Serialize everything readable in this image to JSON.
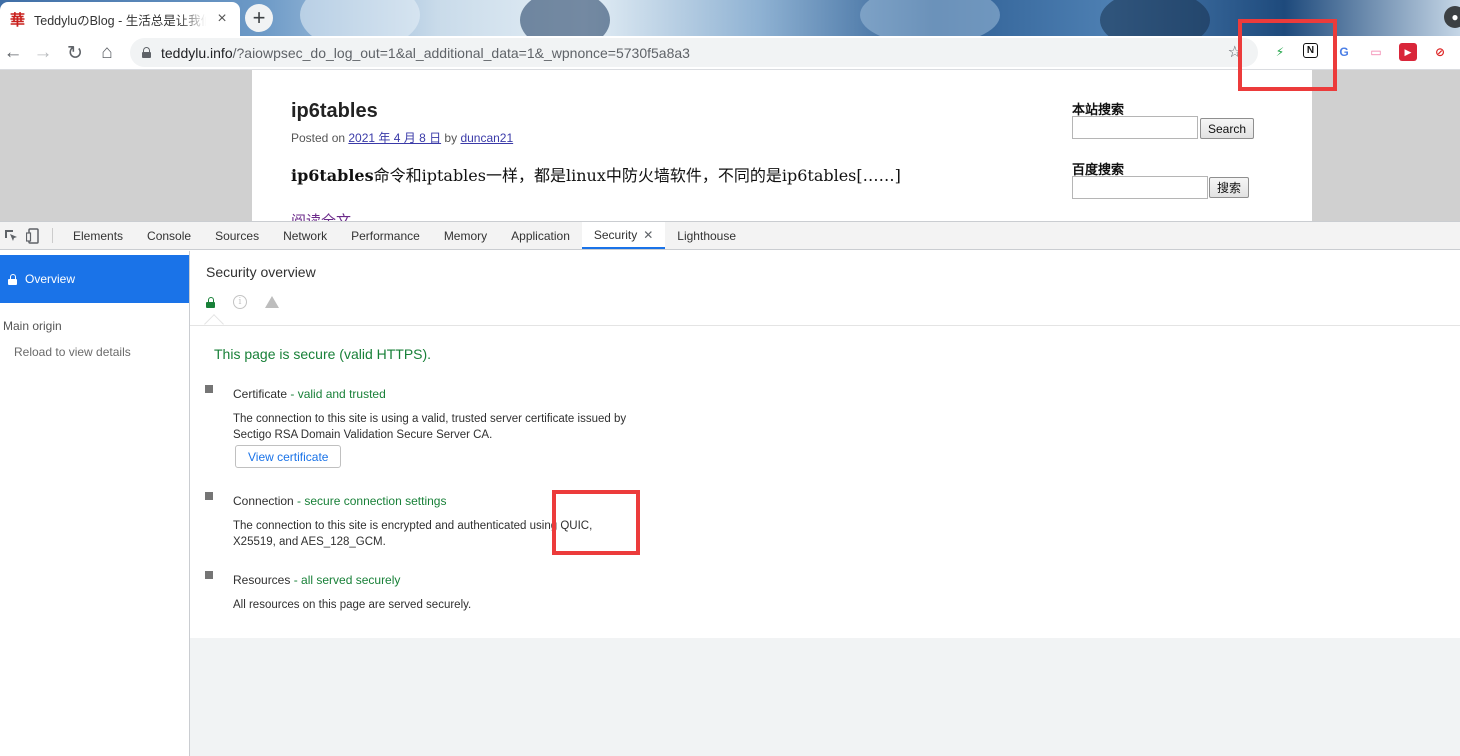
{
  "browser": {
    "tab": {
      "favicon": "華",
      "title": "TeddyluのBlog - 生活总是让我们遍体鳞伤",
      "close": "×"
    },
    "new_tab": "+",
    "nav": {
      "back": "←",
      "forward": "→",
      "reload": "↻",
      "home": "⌂"
    },
    "url": {
      "host": "teddylu.info",
      "path": "/?aiowpsec_do_log_out=1&al_additional_data=1&_wpnonce=5730f5a8a3"
    },
    "bookmark_star": "☆",
    "extensions": [
      {
        "icon": "bolt-icon",
        "glyph": "⚡",
        "color": "#1ea446"
      },
      {
        "icon": "notion-icon",
        "glyph": "N",
        "color": "#111111"
      },
      {
        "icon": "translate-icon",
        "glyph": "G",
        "color": "#4a7ee6"
      },
      {
        "icon": "bilibili-icon",
        "glyph": "▭",
        "color": "#f17aa7"
      },
      {
        "icon": "play-forward-icon",
        "glyph": "▶",
        "color": "#d9263a"
      },
      {
        "icon": "block-icon",
        "glyph": "⊘",
        "color": "#d22"
      }
    ]
  },
  "page": {
    "post_title": "ip6tables",
    "meta_prefix": "Posted on ",
    "meta_date": "2021 年 4 月 8 日",
    "meta_by": " by ",
    "meta_author": "duncan21",
    "excerpt_bold": "ip6tables",
    "excerpt_rest": "命令和iptables一样，都是linux中防火墙软件，不同的是ip6tables[……]",
    "read_more": "阅读全文",
    "search_widget_title": "本站搜索",
    "search_button": "Search",
    "baidu_widget_title": "百度搜索",
    "baidu_button": "搜索"
  },
  "devtools": {
    "tabs": [
      {
        "label": "Elements"
      },
      {
        "label": "Console"
      },
      {
        "label": "Sources"
      },
      {
        "label": "Network"
      },
      {
        "label": "Performance"
      },
      {
        "label": "Memory"
      },
      {
        "label": "Application"
      },
      {
        "label": "Security",
        "active": true,
        "close": "✕"
      },
      {
        "label": "Lighthouse"
      }
    ],
    "sidebar": {
      "overview": "Overview",
      "section": "Main origin",
      "item": "Reload to view details"
    },
    "security": {
      "title": "Security overview",
      "info_glyph": "i",
      "secure_message": "This page is secure (valid HTTPS).",
      "certificate": {
        "title": "Certificate",
        "status": " - valid and trusted",
        "desc": "The connection to this site is using a valid, trusted server certificate issued by Sectigo RSA Domain Validation Secure Server CA.",
        "button": "View certificate"
      },
      "connection": {
        "title": "Connection",
        "status": " - secure connection settings",
        "desc": "The connection to this site is encrypted and authenticated using QUIC, X25519, and AES_128_GCM."
      },
      "resources": {
        "title": "Resources",
        "status": " - all served securely",
        "desc": "All resources on this page are served securely."
      }
    }
  },
  "colors": {
    "accent": "#1a73e8",
    "secure_green": "#188038",
    "annotation_red": "#ec3b3b"
  }
}
